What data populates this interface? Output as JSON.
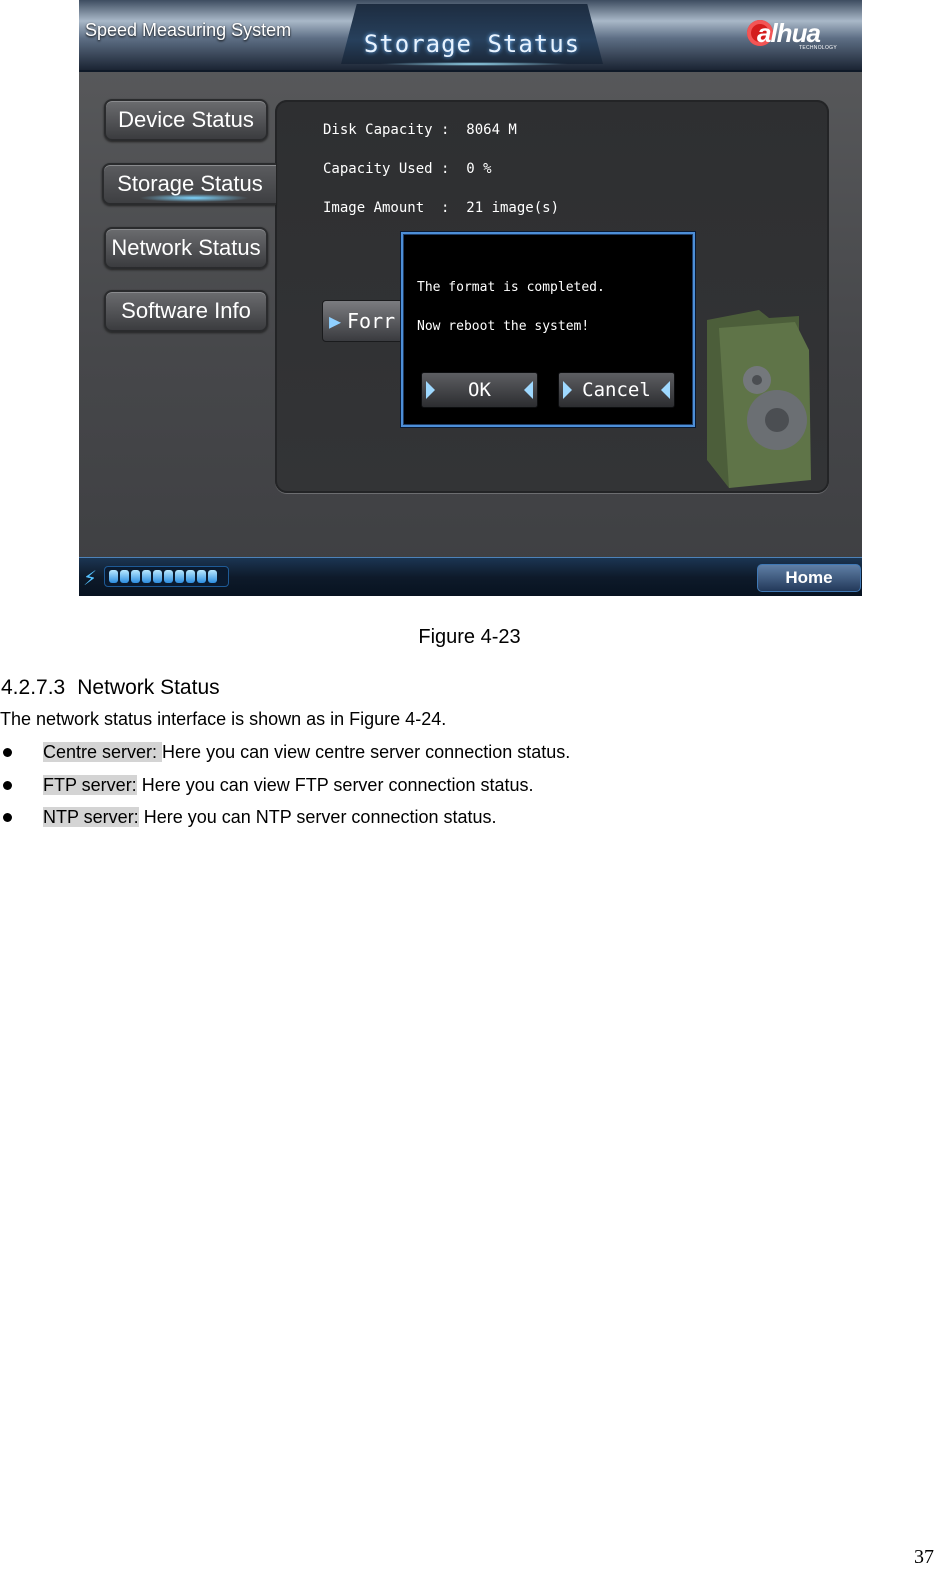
{
  "screenshot": {
    "app_title": "Speed Measuring System",
    "screen_title": "Storage Status",
    "logo": {
      "text": "alhua",
      "subtext": "TECHNOLOGY"
    },
    "nav": [
      {
        "label": "Device Status"
      },
      {
        "label": "Storage Status",
        "active": true
      },
      {
        "label": "Network Status"
      },
      {
        "label": "Software Info"
      }
    ],
    "info": [
      {
        "label": "Disk Capacity :  8064 M"
      },
      {
        "label": "Capacity Used :  0 %"
      },
      {
        "label": "Image Amount  :  21 image(s)"
      }
    ],
    "format_button": "Forr",
    "dialog": {
      "line1": "The format is completed.",
      "line2": "Now reboot the system!",
      "ok": "OK",
      "cancel": "Cancel"
    },
    "progress_segments": 10,
    "home": "Home",
    "colors": {
      "dialog_border": "#4d8fd8",
      "progress": "#2c8de0",
      "logo_red": "#d41c1c"
    }
  },
  "document": {
    "caption": "Figure 4-23",
    "heading_number": "4.2.7.3",
    "heading_title": "Network Status",
    "intro": "The network status interface is shown as in Figure 4-24.",
    "bullets": [
      {
        "term": "Centre server: ",
        "text": "Here you can view centre server connection status."
      },
      {
        "term": "FTP server:",
        "text": " Here you can view FTP server connection status."
      },
      {
        "term": "NTP server:",
        "text": " Here you can NTP server connection status."
      }
    ],
    "page_number": "37"
  }
}
